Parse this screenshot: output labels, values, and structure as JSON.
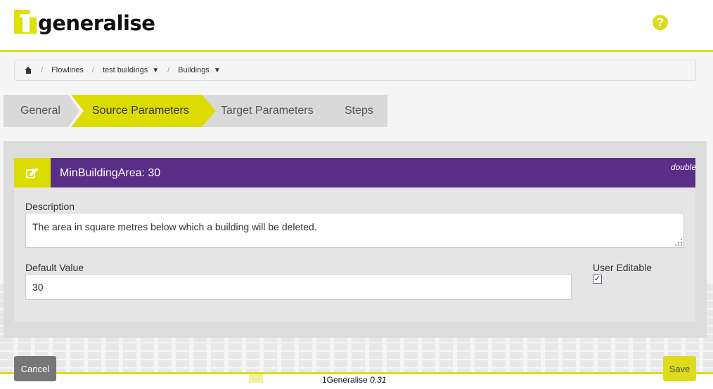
{
  "header": {
    "logo_text": "generalise",
    "help_glyph": "?"
  },
  "breadcrumb": {
    "items": [
      {
        "label": "Flowlines"
      },
      {
        "label": "test buildings",
        "caret": "▼"
      },
      {
        "label": "Buildings",
        "caret": "▼"
      }
    ],
    "separator": "/"
  },
  "tabs": [
    {
      "label": "General",
      "active": false
    },
    {
      "label": "Source Parameters",
      "active": true
    },
    {
      "label": "Target Parameters",
      "active": false
    },
    {
      "label": "Steps",
      "active": false
    }
  ],
  "parameter": {
    "title": "MinBuildingArea: 30",
    "type": "double",
    "description_label": "Description",
    "description_value": "The area in square metres below which a building will be deleted.",
    "default_value_label": "Default Value",
    "default_value": "30",
    "user_editable_label": "User Editable",
    "user_editable": true,
    "check_glyph": "✓"
  },
  "footer": {
    "cancel_label": "Cancel",
    "save_label": "Save",
    "app_name": "1Generalise",
    "version": "0.31"
  },
  "colors": {
    "accent": "#dcdc1c",
    "header_purple": "#5a2d87",
    "cancel_gray": "#777777"
  },
  "icons": [
    "home-icon",
    "help-icon",
    "edit-icon",
    "check-icon"
  ]
}
